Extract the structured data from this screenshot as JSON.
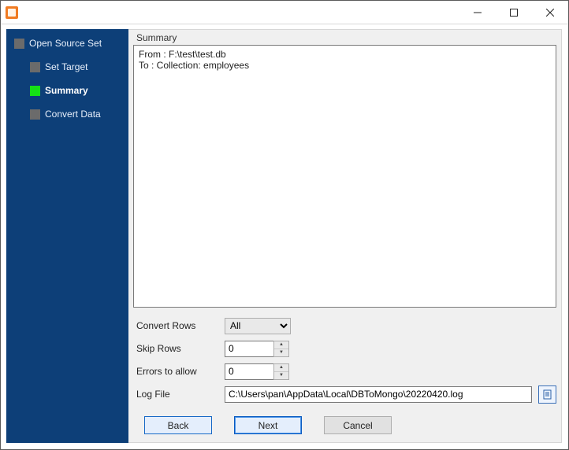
{
  "titlebar": {
    "title": ""
  },
  "sidebar": {
    "steps": [
      {
        "label": "Open Source Set"
      },
      {
        "label": "Set Target"
      },
      {
        "label": "Summary"
      },
      {
        "label": "Convert Data"
      }
    ]
  },
  "main": {
    "summary_label": "Summary",
    "summary_text": "From : F:\\test\\test.db\nTo : Collection: employees",
    "form": {
      "convert_rows_label": "Convert Rows",
      "convert_rows_value": "All",
      "skip_rows_label": "Skip Rows",
      "skip_rows_value": "0",
      "errors_label": "Errors to allow",
      "errors_value": "0",
      "log_file_label": "Log File",
      "log_file_value": "C:\\Users\\pan\\AppData\\Local\\DBToMongo\\20220420.log"
    },
    "buttons": {
      "back": "Back",
      "next": "Next",
      "cancel": "Cancel"
    }
  }
}
